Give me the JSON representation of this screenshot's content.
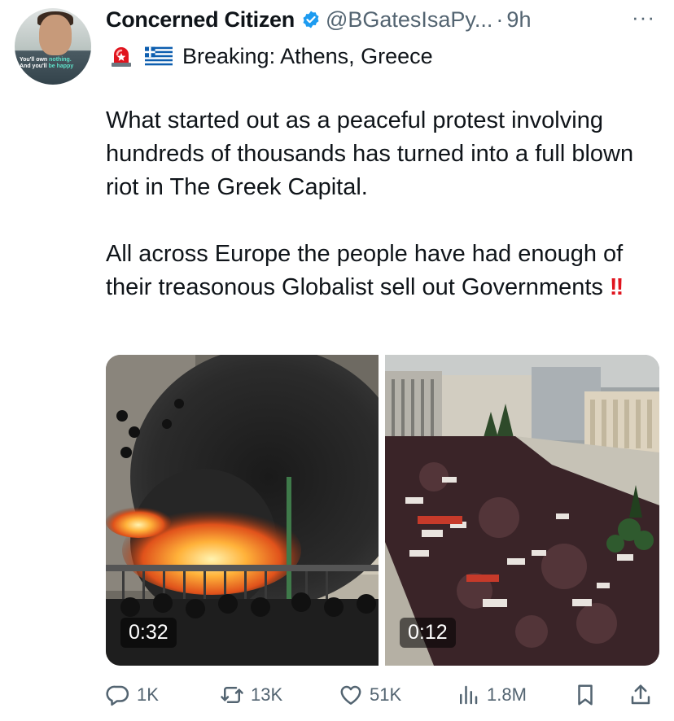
{
  "tweet": {
    "author_name": "Concerned Citizen",
    "handle": "@BGatesIsaPy...",
    "separator": "·",
    "time": "9h",
    "more": "···",
    "avatar_caption_line1": "You'll own ",
    "avatar_caption_hl1": "nothing.",
    "avatar_caption_line2": "And you'll ",
    "avatar_caption_hl2": "be happy",
    "headline": "Breaking: Athens, Greece",
    "paragraph1": "What started out as a peaceful protest involving hundreds of thousands has turned into a full blown riot in The Greek Capital.",
    "paragraph2": "All across Europe the people have had enough of their treasonous Globalist sell out Governments",
    "paragraph2_emphasis": "!!"
  },
  "media": {
    "video1_duration": "0:32",
    "video2_duration": "0:12"
  },
  "actions": {
    "replies": "1K",
    "reposts": "13K",
    "likes": "51K",
    "views": "1.8M"
  },
  "icons": {
    "verified": "verified-badge-icon",
    "siren": "police-siren-icon",
    "flag": "greece-flag-icon",
    "reply": "reply-icon",
    "repost": "repost-icon",
    "like": "heart-icon",
    "views": "views-chart-icon",
    "bookmark": "bookmark-icon",
    "share": "share-icon"
  },
  "colors": {
    "verified_blue": "#1d9bf0",
    "secondary_text": "#536471",
    "emphasis_red": "#e0141e"
  }
}
